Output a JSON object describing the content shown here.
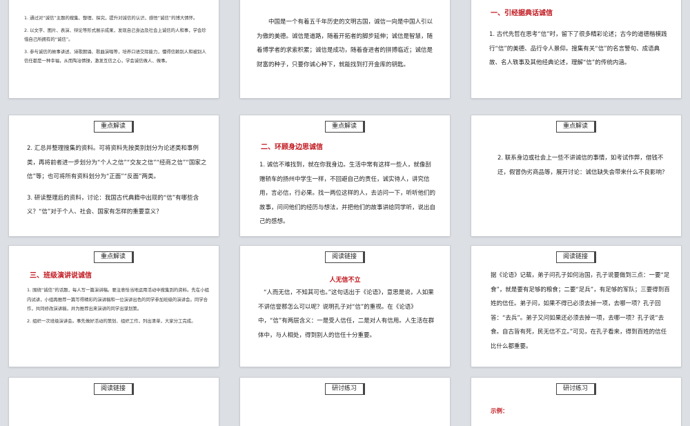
{
  "slides": {
    "s1": {
      "items": [
        "1. 通过对“诚信”主题的搜集、整理、探究，提升对诚信的认识，感悟“诚信”的博大情怀。",
        "2. 以文字、图片、表演、辩论等形式展示成果，发现自己身边及社会上诚信的人和事，学会珍惜自己所拥有的“诚信”。",
        "3. 参与诚信的故事讲述、诗歌朗诵、歌曲演唱等，培养口语交际能力，懂得信赖别人和被别人信任都是一种幸福，从而陶冶情操，激发互信之心，学会诚信做人、做事。"
      ]
    },
    "s2": {
      "text": "中国是一个有着五千年历史的文明古国，诚信一向是中国人引以为傲的美德。诚信是道路，随着开拓者的脚步延伸；诚信是智慧，随着博学者的求索积累；诚信是成功，随着奋进者的拼搏临近；诚信是财富的种子，只要你诚心种下，就能找到打开金库的钥匙。"
    },
    "s3": {
      "heading": "一、引经据典话诚信",
      "text": "1. 古代先哲在思考“信”时，留下了很多精彩论述；古今的道德楷模践行“信”的美德、品行令人景仰。搜集有关“信”的名言警句、成语典故、名人轶事及其他经典论述，理解“信”的传统内涵。"
    },
    "s4": {
      "tag": "重点解读",
      "p1": "2. 汇总并整理搜集的资料。可将资料先按类别划分为论述类和事例类，再将前者进一步划分为“个人之信”“交友之信”“经商之信”“国家之信”等；也可将所有资料划分为“正面”“反面”两类。",
      "p2": "3. 研读整理后的资料，讨论：我国古代典籍中出现的“信”有哪些含义？“信”对于个人、社会、国家有怎样的重要意义？"
    },
    "s5": {
      "tag": "重点解读",
      "heading": "二、环顾身边思诚信",
      "text": "1. 诚信不难找到，就在你我身边。生活中常有这样一些人，就像刮赠轿车的扬州中学生一样，不回避自己的责任，诚实待人，讲究信用，言必信，行必果。找一两位这样的人，去访问一下，听听他们的故事，问问他们的经历与想法，并把他们的故事讲给同学听，说出自己的感想。"
    },
    "s6": {
      "tag": "重点解读",
      "text": "2. 联系身边或社会上一些不讲诚信的事情，如考试作弊，借钱不还，假冒伪劣商品等，展开讨论：诚信缺失会带来什么不良影响？"
    },
    "s7": {
      "tag": "重点解读",
      "heading": "三、班级演讲说诚信",
      "items": [
        "1. 围绕“诚信”的话题，每人写一篇演讲稿。要注意恰当地运用活动中搜集到的资料。先在小组内试讲，小组再推荐一篇写得精彩的演讲稿和一位演讲出色的同学参加班级的演讲会。同学合作，共同修改演讲稿，并为推荐出来演讲的同学出谋划策。",
        "2. 组织一次班级演讲会。事先做好活动的策划、组织工作，列出清单，大家分工完成。"
      ]
    },
    "s8": {
      "tag": "阅读链接",
      "heading": "人无信不立",
      "text": "“人而无信，不知其可也。”这句话出于《论语》，意思是说，人如果不讲信誉那怎么可以呢？说明孔子对“信”的重视。在《论语》中，“信”有两层含义：一是受人信任，二是对人有信用。人生活在群体中，与人相处，得到别人的信任十分重要。"
    },
    "s9": {
      "tag": "阅读链接",
      "text": "据《论语》记载，弟子问孔子如何治国，孔子说要做到三点：一要“足食”，就是要有足够的粮食；二要“足兵”，有足够的军队；三要得到百姓的信任。弟子问，如果不得已必须去掉一项，去哪一项？孔子回答：“去兵”。弟子又问如果还必须去掉一项，去哪一项？孔子说“去食。自古皆有死，民无信不立。”可见，在孔子看来，得到百姓的信任比什么都重要。"
    },
    "s10": {
      "tag": "阅读链接"
    },
    "s11": {
      "tag": "研讨练习"
    },
    "s12": {
      "tag": "研讨练习",
      "heading": "示例："
    }
  }
}
